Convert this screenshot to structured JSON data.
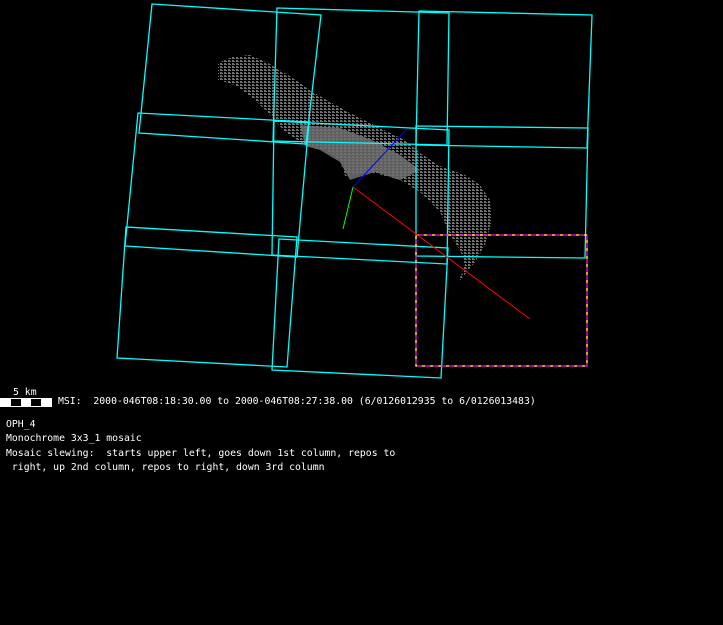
{
  "scale": {
    "label": "5 km"
  },
  "msi_line": "MSI:  2000-046T08:18:30.00 to 2000-046T08:27:38.00 (6/0126012935 to 6/0126013483)",
  "info": {
    "name": "OPH_4",
    "mosaic": "Monochrome 3x3_1 mosaic",
    "slewing_1": "Mosaic slewing:  starts upper left, goes down 1st column, repos to",
    "slewing_2": " right, up 2nd column, repos to right, down 3rd column"
  },
  "colors": {
    "frame": "#00ffff",
    "highlight_frame": "#ff00ff",
    "highlight_dash": "#ffff00",
    "asteroid": "#707070",
    "axis_x": "#ff0000",
    "axis_y": "#00ff00",
    "axis_z": "#0000ff"
  },
  "frames_count": 9
}
